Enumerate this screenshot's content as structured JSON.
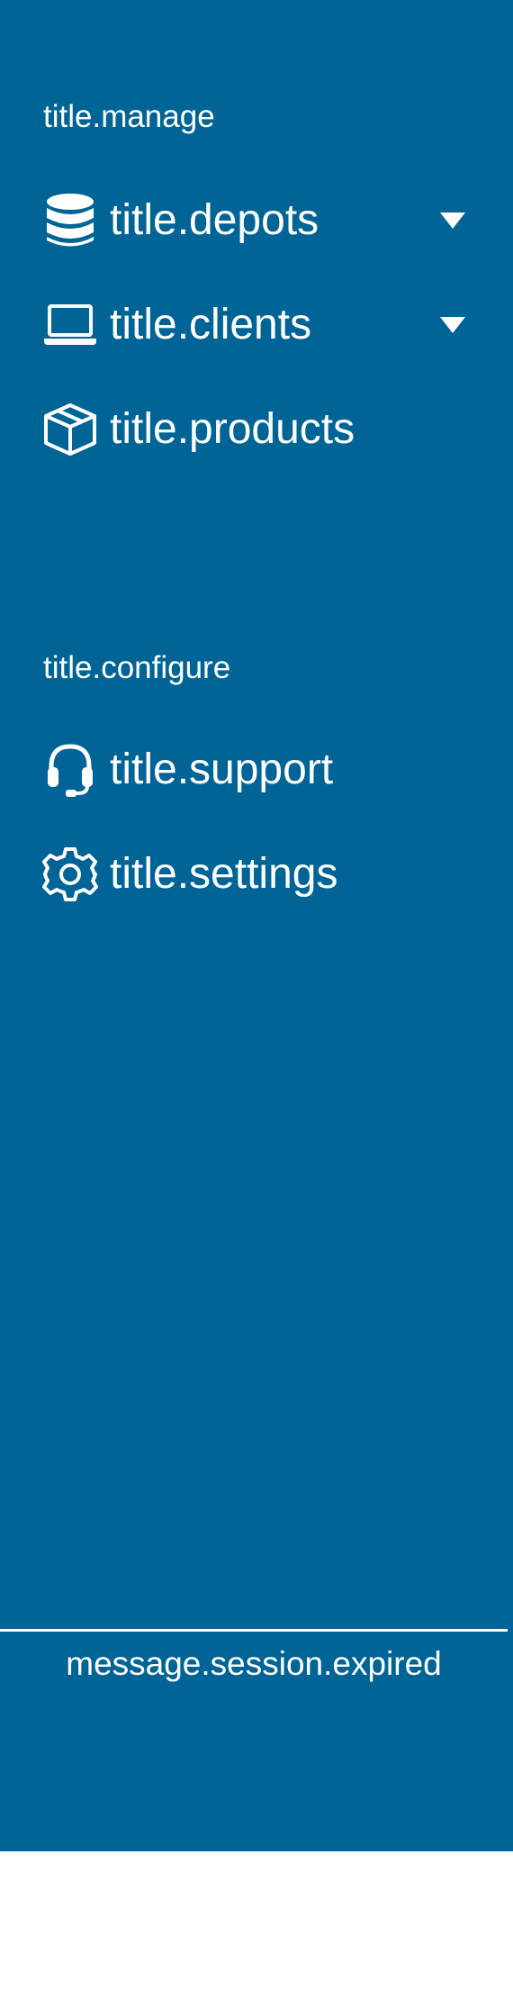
{
  "sidebar": {
    "manage_title": "title.manage",
    "manage_items": [
      {
        "label": "title.depots",
        "icon": "database-icon",
        "expandable": true
      },
      {
        "label": "title.clients",
        "icon": "laptop-icon",
        "expandable": true
      },
      {
        "label": "title.products",
        "icon": "box-icon",
        "expandable": false
      }
    ],
    "configure_title": "title.configure",
    "configure_items": [
      {
        "label": "title.support",
        "icon": "headset-icon"
      },
      {
        "label": "title.settings",
        "icon": "gear-icon"
      }
    ],
    "footer_message": "message.session.expired"
  },
  "colors": {
    "sidebar_background": "#006496",
    "text": "#ffffff",
    "page_background": "#ffffff"
  }
}
